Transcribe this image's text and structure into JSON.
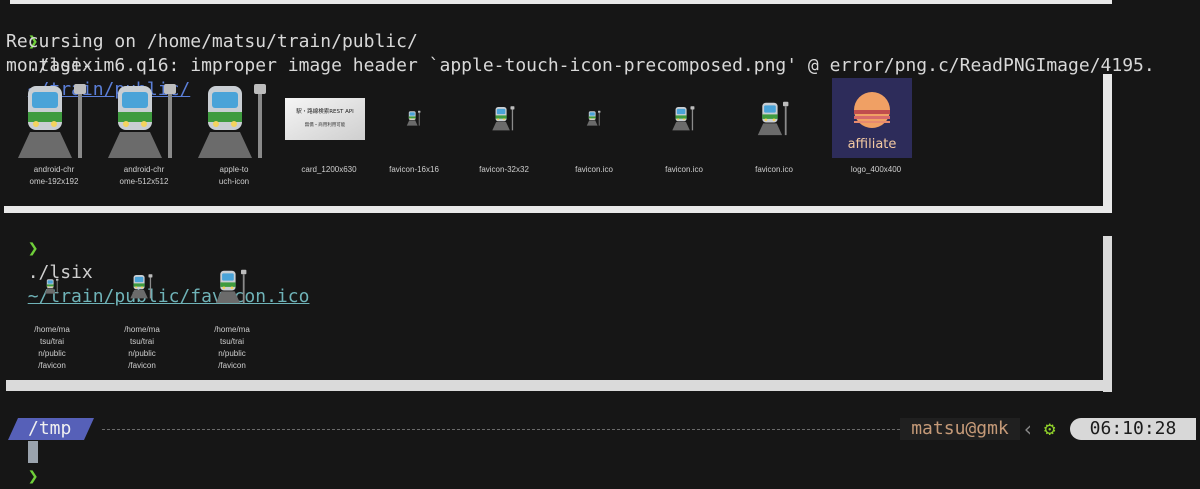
{
  "terminal": {
    "prompt_symbol": "❯",
    "commands": [
      {
        "cmd": "./lsix",
        "arg": "~/train/public/"
      },
      {
        "cmd": "./lsix",
        "arg": "~/train/public/favicon.ico"
      }
    ],
    "output_lines": [
      "Recursing on /home/matsu/train/public/",
      "montage-im6.q16: improper image header `apple-touch-icon-precomposed.png' @ error/png.c/ReadPNGImage/4195."
    ],
    "montage1": [
      {
        "caption1": "android-chr",
        "caption2": "ome-192x192",
        "icon": "train-icon"
      },
      {
        "caption1": "android-chr",
        "caption2": "ome-512x512",
        "icon": "train-icon"
      },
      {
        "caption1": "apple-to",
        "caption2": "uch-icon",
        "icon": "train-icon"
      },
      {
        "caption1": "card_1200x630",
        "caption2": "",
        "icon": "card-image",
        "card_title": "駅・路線検索REST API",
        "card_sub": "無償・商用利用可能"
      },
      {
        "caption1": "favicon-16x16",
        "caption2": "",
        "icon": "train-icon"
      },
      {
        "caption1": "favicon-32x32",
        "caption2": "",
        "icon": "train-icon"
      },
      {
        "caption1": "favicon.ico",
        "caption2": "",
        "icon": "train-icon"
      },
      {
        "caption1": "favicon.ico",
        "caption2": "",
        "icon": "train-icon"
      },
      {
        "caption1": "favicon.ico",
        "caption2": "",
        "icon": "train-icon"
      },
      {
        "caption1": "logo_400x400",
        "caption2": "",
        "icon": "affiliate-logo",
        "logo_text": "affiliate"
      }
    ],
    "montage2": [
      {
        "l1": "/home/ma",
        "l2": "tsu/trai",
        "l3": "n/public",
        "l4": "/favicon",
        "icon": "train-icon"
      },
      {
        "l1": "/home/ma",
        "l2": "tsu/trai",
        "l3": "n/public",
        "l4": "/favicon",
        "icon": "train-icon"
      },
      {
        "l1": "/home/ma",
        "l2": "tsu/trai",
        "l3": "n/public",
        "l4": "/favicon",
        "icon": "train-icon"
      }
    ]
  },
  "statusbar": {
    "cwd": "/tmp",
    "user_host": "matsu@gmk",
    "gear_icon": "gear-icon",
    "time": "06:10:28"
  },
  "colors": {
    "background": "#161616",
    "prompt_green": "#6fcf3a",
    "path_blue": "#5b7fd8",
    "path_teal": "#6fb3b8",
    "cwd_badge": "#5660b8",
    "user_host": "#c59a78"
  }
}
